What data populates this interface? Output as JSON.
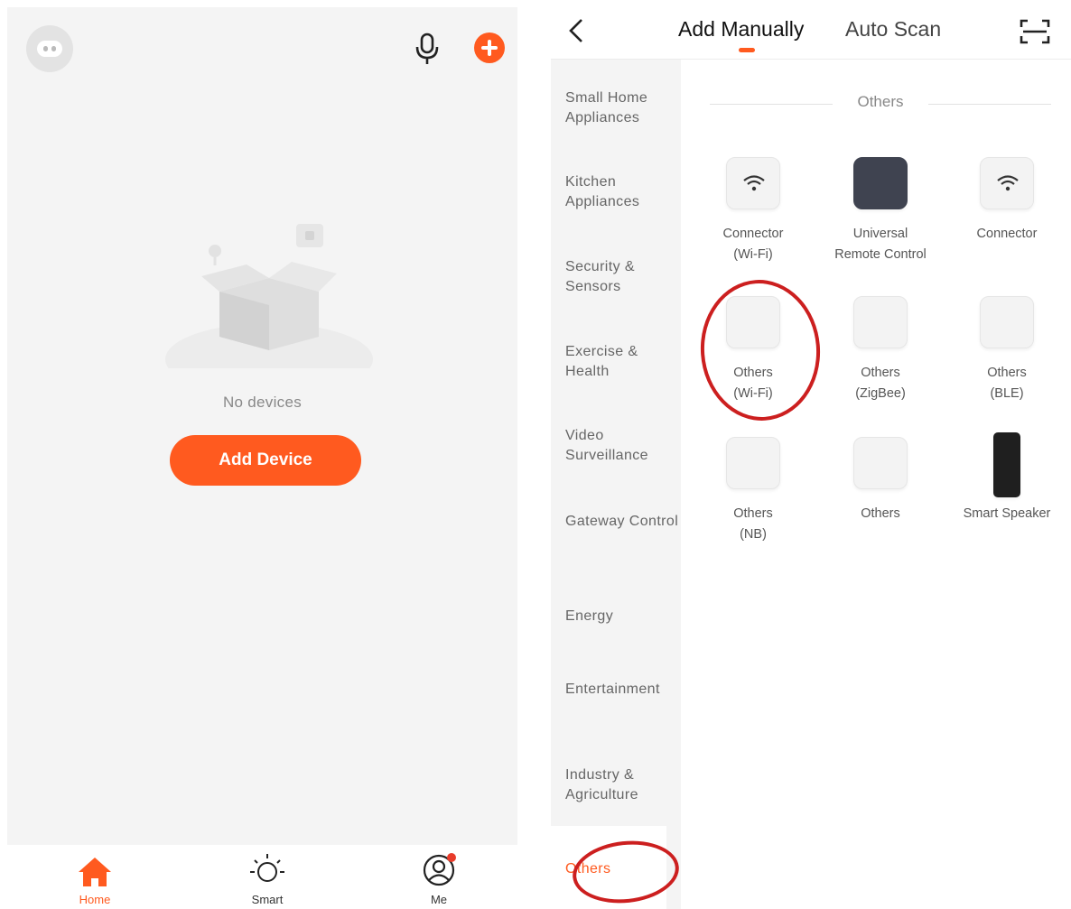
{
  "home": {
    "empty_text": "No devices",
    "add_button": "Add Device",
    "tabs": [
      {
        "label": "Home",
        "icon": "home-icon",
        "active": true
      },
      {
        "label": "Smart",
        "icon": "sun-icon",
        "active": false
      },
      {
        "label": "Me",
        "icon": "profile-icon",
        "active": false,
        "badge": true
      }
    ]
  },
  "add_device": {
    "tabs": [
      {
        "label": "Add Manually",
        "active": true
      },
      {
        "label": "Auto Scan",
        "active": false
      }
    ],
    "categories": [
      "Small Home Appliances",
      "Kitchen Appliances",
      "Security & Sensors",
      "Exercise & Health",
      "Video Surveillance",
      "Gateway Control",
      "Energy",
      "Entertainment",
      "Industry & Agriculture",
      "Others"
    ],
    "selected_category": "Others",
    "section_title": "Others",
    "devices": [
      {
        "line1": "Connector",
        "line2": "(Wi-Fi)",
        "icon": "wifi-icon"
      },
      {
        "line1": "Universal",
        "line2": "Remote Control",
        "icon": "remote-icon"
      },
      {
        "line1": "Connector",
        "line2": "",
        "icon": "wifi-icon"
      },
      {
        "line1": "Others",
        "line2": "(Wi-Fi)",
        "icon": "device-icon"
      },
      {
        "line1": "Others",
        "line2": "(ZigBee)",
        "icon": "device-icon"
      },
      {
        "line1": "Others",
        "line2": "(BLE)",
        "icon": "device-icon"
      },
      {
        "line1": "Others",
        "line2": "(NB)",
        "icon": "device-icon"
      },
      {
        "line1": "Others",
        "line2": "",
        "icon": "device-icon"
      },
      {
        "line1": "Smart Speaker",
        "line2": "",
        "icon": "speaker-icon"
      }
    ]
  },
  "colors": {
    "accent": "#ff5a1f",
    "annotation": "#cc1f1f"
  }
}
